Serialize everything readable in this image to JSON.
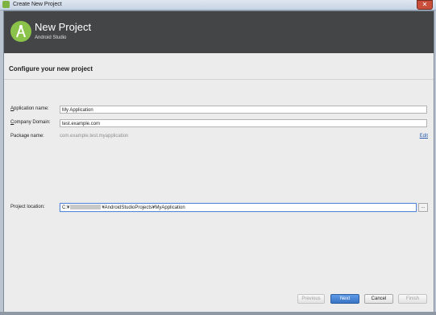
{
  "window": {
    "title": "Create New Project"
  },
  "header": {
    "title": "New Project",
    "subtitle": "Android Studio"
  },
  "section": {
    "title": "Configure your new project"
  },
  "form": {
    "app_name_label_mnemonic": "A",
    "app_name_label_rest": "pplication name:",
    "app_name_value": "My Application",
    "domain_label_mnemonic": "C",
    "domain_label_rest": "ompany Domain:",
    "domain_value": "test.example.com",
    "package_label": "Package name:",
    "package_value": "com.example.test.myapplication",
    "edit_label": "Edit",
    "location_label": "Project location:",
    "location_prefix": "C:¥",
    "location_suffix": "¥AndroidStudioProjects¥MyApplication",
    "browse_label": "..."
  },
  "buttons": {
    "previous": "Previous",
    "next": "Next",
    "cancel": "Cancel",
    "finish": "Finish"
  },
  "colors": {
    "header_bg": "#434547",
    "accent": "#3a73c4",
    "logo": "#8bc34a"
  }
}
